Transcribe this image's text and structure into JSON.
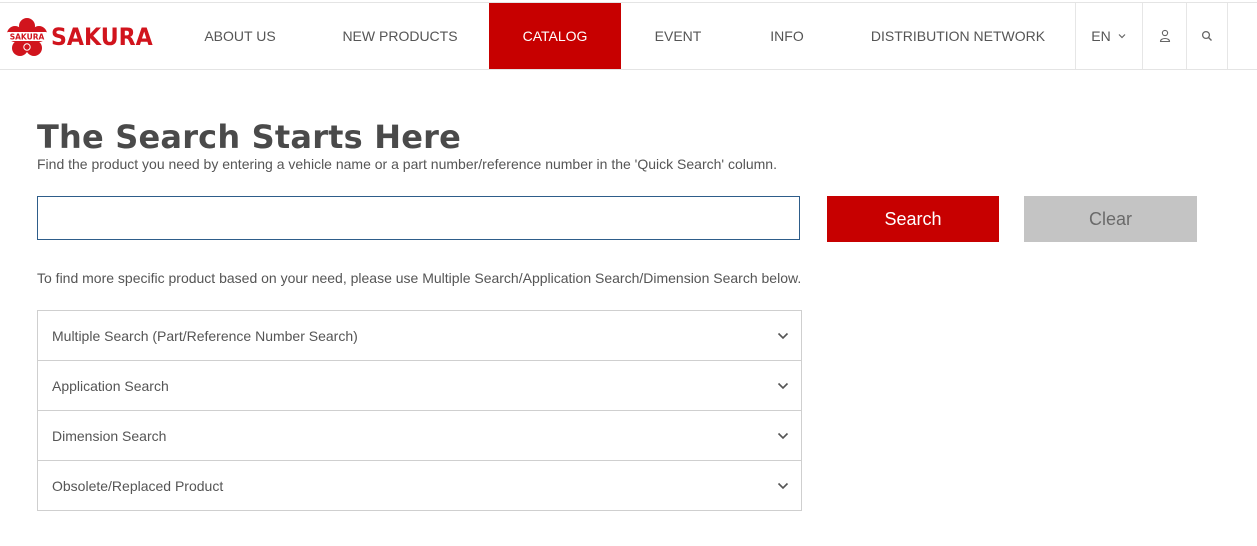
{
  "brand": {
    "name": "SAKURA",
    "badge_text": "SAKURA",
    "color": "#d1141d"
  },
  "nav": {
    "items": [
      {
        "label": "ABOUT US",
        "active": false
      },
      {
        "label": "NEW PRODUCTS",
        "active": false
      },
      {
        "label": "CATALOG",
        "active": true
      },
      {
        "label": "EVENT",
        "active": false
      },
      {
        "label": "INFO",
        "active": false
      },
      {
        "label": "DISTRIBUTION NETWORK",
        "active": false
      }
    ],
    "language": "EN",
    "icons": [
      "chevron-down-icon",
      "user-icon",
      "search-icon"
    ]
  },
  "main": {
    "title": "The Search Starts Here",
    "subtitle": "Find the product you need by entering a vehicle name or a part number/reference number in the 'Quick Search' column.",
    "search_value": "",
    "search_label": "Search",
    "clear_label": "Clear",
    "hint": "To find more specific product based on your need, please use Multiple Search/Application Search/Dimension Search below.",
    "accordion": [
      {
        "label": "Multiple Search (Part/Reference Number Search)"
      },
      {
        "label": "Application Search"
      },
      {
        "label": "Dimension Search"
      },
      {
        "label": "Obsolete/Replaced Product"
      }
    ]
  },
  "colors": {
    "accent": "#c70000",
    "clear_button": "#c4c4c4",
    "input_border": "#2e5d8a"
  }
}
